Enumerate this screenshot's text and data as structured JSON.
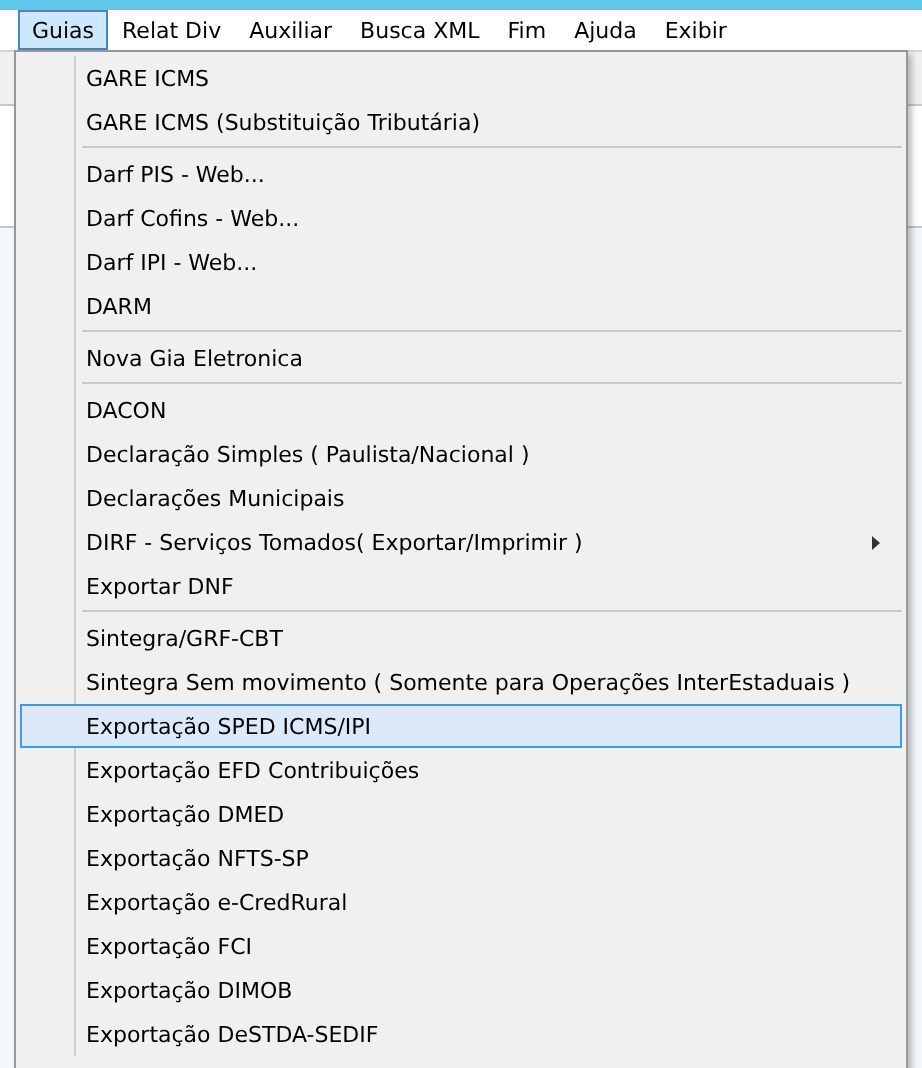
{
  "menubar": [
    {
      "label": "Guias",
      "selected": true
    },
    {
      "label": "Relat Div",
      "selected": false
    },
    {
      "label": "Auxiliar",
      "selected": false
    },
    {
      "label": "Busca XML",
      "selected": false
    },
    {
      "label": "Fim",
      "selected": false
    },
    {
      "label": "Ajuda",
      "selected": false
    },
    {
      "label": "Exibir",
      "selected": false
    }
  ],
  "menu": {
    "groups": [
      {
        "items": [
          {
            "label": "GARE ICMS",
            "selected": false,
            "submenu": false
          },
          {
            "label": "GARE ICMS (Substituição Tributária)",
            "selected": false,
            "submenu": false
          }
        ]
      },
      {
        "items": [
          {
            "label": "Darf PIS - Web...",
            "selected": false,
            "submenu": false
          },
          {
            "label": "Darf Cofins - Web...",
            "selected": false,
            "submenu": false
          },
          {
            "label": "Darf IPI - Web...",
            "selected": false,
            "submenu": false
          },
          {
            "label": "DARM",
            "selected": false,
            "submenu": false
          }
        ]
      },
      {
        "items": [
          {
            "label": "Nova Gia Eletronica",
            "selected": false,
            "submenu": false
          }
        ]
      },
      {
        "items": [
          {
            "label": "DACON",
            "selected": false,
            "submenu": false
          },
          {
            "label": "Declaração Simples ( Paulista/Nacional )",
            "selected": false,
            "submenu": false
          },
          {
            "label": "Declarações Municipais",
            "selected": false,
            "submenu": false
          },
          {
            "label": "DIRF - Serviços Tomados( Exportar/Imprimir )",
            "selected": false,
            "submenu": true
          },
          {
            "label": "Exportar DNF",
            "selected": false,
            "submenu": false
          }
        ]
      },
      {
        "items": [
          {
            "label": "Sintegra/GRF-CBT",
            "selected": false,
            "submenu": false
          },
          {
            "label": "Sintegra Sem movimento ( Somente para Operações InterEstaduais )",
            "selected": false,
            "submenu": false
          },
          {
            "label": "Exportação SPED ICMS/IPI",
            "selected": true,
            "submenu": false
          },
          {
            "label": "Exportação EFD Contribuições",
            "selected": false,
            "submenu": false
          },
          {
            "label": "Exportação DMED",
            "selected": false,
            "submenu": false
          },
          {
            "label": "Exportação NFTS-SP",
            "selected": false,
            "submenu": false
          },
          {
            "label": "Exportação e-CredRural",
            "selected": false,
            "submenu": false
          },
          {
            "label": "Exportação FCI",
            "selected": false,
            "submenu": false
          },
          {
            "label": "Exportação DIMOB",
            "selected": false,
            "submenu": false
          },
          {
            "label": "Exportação DeSTDA-SEDIF",
            "selected": false,
            "submenu": false
          }
        ]
      }
    ]
  }
}
